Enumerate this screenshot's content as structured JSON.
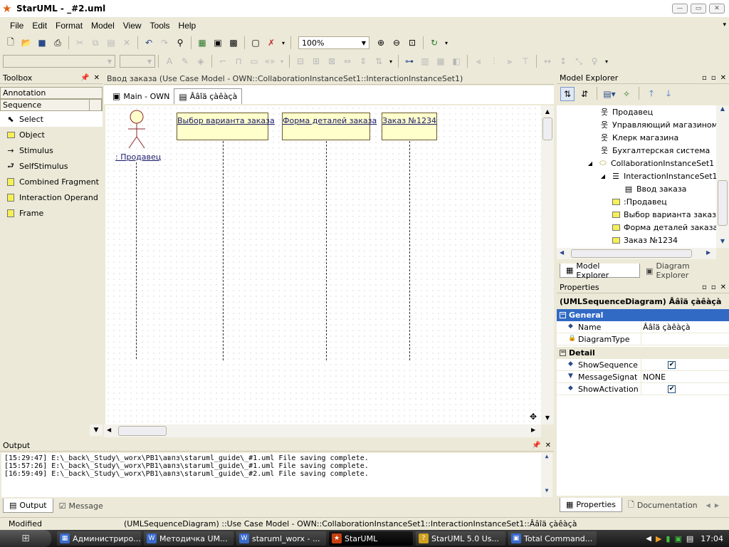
{
  "window": {
    "title": "StarUML - _#2.uml"
  },
  "menu": [
    "File",
    "Edit",
    "Format",
    "Model",
    "View",
    "Tools",
    "Help"
  ],
  "toolbar": {
    "zoom": "100%"
  },
  "toolbox": {
    "title": "Toolbox",
    "categories": [
      "Annotation",
      "Sequence"
    ],
    "items": [
      {
        "label": "Select",
        "icon": "cursor-icon"
      },
      {
        "label": "Object",
        "icon": "object-icon"
      },
      {
        "label": "Stimulus",
        "icon": "arrow-right-icon"
      },
      {
        "label": "SelfStimulus",
        "icon": "self-stimulus-icon"
      },
      {
        "label": "Combined Fragment",
        "icon": "combined-fragment-icon"
      },
      {
        "label": "Interaction Operand",
        "icon": "interaction-operand-icon"
      },
      {
        "label": "Frame",
        "icon": "frame-icon"
      }
    ]
  },
  "diagram": {
    "path": "Ввод заказа (Use Case Model - OWN::CollaborationInstanceSet1::InteractionInstanceSet1)",
    "tabs": [
      "Main - OWN",
      "Ââîä çàêàçà"
    ],
    "actor": ": Продавец",
    "lifelines": [
      "Выбор варианта заказа",
      "Форма деталей заказа",
      "Заказ №1234"
    ]
  },
  "model_explorer": {
    "title": "Model Explorer",
    "tree": [
      "Продавец",
      "Управляющий магазином",
      "Клерк магазина",
      "Бухгалтерская система",
      "CollaborationInstanceSet1",
      "InteractionInstanceSet1",
      "Ввод заказа",
      ":Продавец",
      "Выбор варианта заказа",
      "Форма деталей заказа",
      "Заказ №1234"
    ],
    "tabs": [
      "Model Explorer",
      "Diagram Explorer"
    ]
  },
  "properties": {
    "title": "Properties",
    "heading": "(UMLSequenceDiagram) Ââîä çàêàçà",
    "general_label": "General",
    "detail_label": "Detail",
    "name_key": "Name",
    "name_val": "Ââîä çàêàçà",
    "type_key": "DiagramType",
    "type_val": "",
    "showseq_key": "ShowSequence",
    "msgsig_key": "MessageSignat",
    "msgsig_val": "NONE",
    "showact_key": "ShowActivation",
    "tabs": [
      "Properties",
      "Documentation"
    ]
  },
  "output": {
    "title": "Output",
    "lines": [
      "[15:29:47]  E:\\_back\\_Study\\_worx\\PB1\\авпз\\staruml_guide\\_#1.uml File saving complete.",
      "[15:57:26]  E:\\_back\\_Study\\_worx\\PB1\\авпз\\staruml_guide\\_#1.uml File saving complete.",
      "[16:59:49]  E:\\_back\\_Study\\_worx\\PB1\\авпз\\staruml_guide\\_#2.uml File saving complete."
    ],
    "tabs": [
      "Output",
      "Message"
    ]
  },
  "status": {
    "mode": "Modified",
    "path": "(UMLSequenceDiagram) ::Use Case Model - OWN::CollaborationInstanceSet1::InteractionInstanceSet1::Ââîä çàêàçà"
  },
  "taskbar": {
    "tasks": [
      "Администриро...",
      "Методичка UM...",
      "staruml_worx - ...",
      "StarUML",
      "StarUML 5.0 Us...",
      "Total Command..."
    ],
    "clock": "17:04"
  }
}
